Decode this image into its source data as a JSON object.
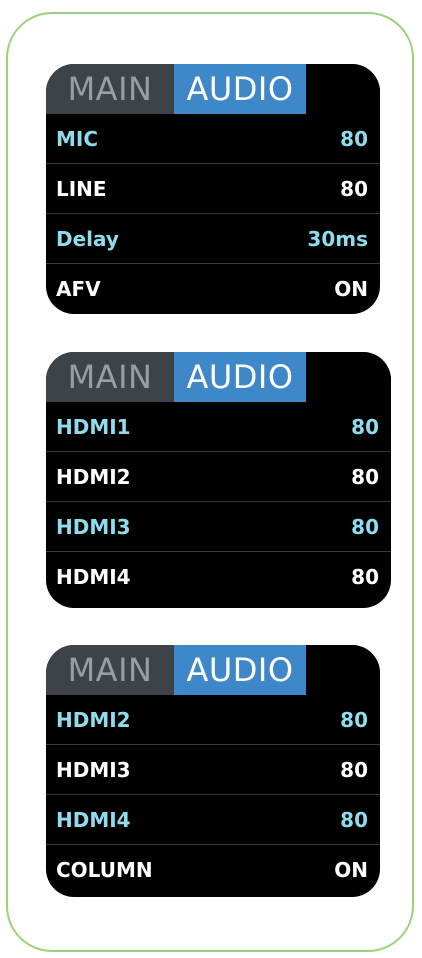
{
  "colors": {
    "frame_border": "#9bd27a",
    "panel_bg": "#000000",
    "tab_main_bg": "#3e434a",
    "tab_audio_bg": "#3e88c9",
    "highlight_text": "#8fdcee",
    "text": "#ffffff"
  },
  "panels": [
    {
      "tabs": {
        "main": "MAIN",
        "audio": "AUDIO"
      },
      "rows": [
        {
          "label": "MIC",
          "value": "80",
          "highlight": true
        },
        {
          "label": "LINE",
          "value": "80",
          "highlight": false
        },
        {
          "label": "Delay",
          "value": "30ms",
          "highlight": true
        },
        {
          "label": "AFV",
          "value": "ON",
          "highlight": false
        }
      ]
    },
    {
      "tabs": {
        "main": "MAIN",
        "audio": "AUDIO"
      },
      "rows": [
        {
          "label": "HDMI1",
          "value": "80",
          "highlight": true
        },
        {
          "label": "HDMI2",
          "value": "80",
          "highlight": false
        },
        {
          "label": "HDMI3",
          "value": "80",
          "highlight": true
        },
        {
          "label": "HDMI4",
          "value": "80",
          "highlight": false
        }
      ]
    },
    {
      "tabs": {
        "main": "MAIN",
        "audio": "AUDIO"
      },
      "rows": [
        {
          "label": "HDMI2",
          "value": "80",
          "highlight": true
        },
        {
          "label": "HDMI3",
          "value": "80",
          "highlight": false
        },
        {
          "label": "HDMI4",
          "value": "80",
          "highlight": true
        },
        {
          "label": "COLUMN",
          "value": "ON",
          "highlight": false
        }
      ]
    }
  ]
}
